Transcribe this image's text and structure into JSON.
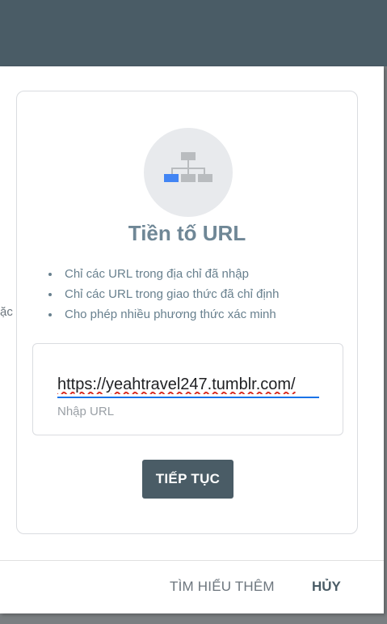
{
  "background_left_text": "ặc",
  "card": {
    "title": "Tiền tố URL",
    "icon": "sitemap-icon",
    "features": [
      "Chỉ các URL trong địa chỉ đã nhập",
      "Chỉ các URL trong giao thức đã chỉ định",
      "Cho phép nhiều phương thức xác minh"
    ],
    "url_input": {
      "value": "https://yeahtravel247.tumblr.com/",
      "helper": "Nhập URL"
    },
    "continue_label": "TIẾP TỤC"
  },
  "footer": {
    "learn_more_label": "TÌM HIỂU THÊM",
    "cancel_label": "HỦY"
  },
  "colors": {
    "topbar": "#4a5c66",
    "accent_blue": "#4285f4",
    "title": "#6f8796"
  }
}
